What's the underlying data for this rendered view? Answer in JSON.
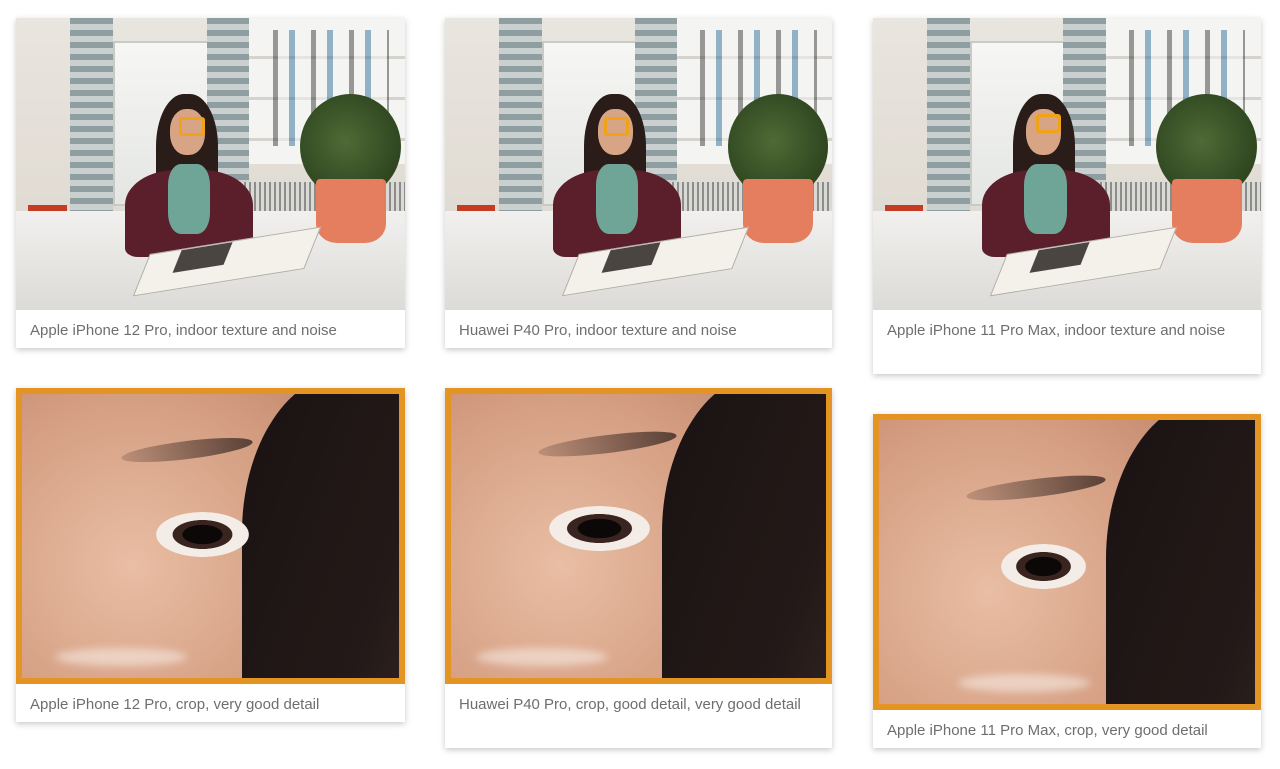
{
  "accent_color": "#e39422",
  "cards": [
    {
      "caption": "Apple iPhone 12 Pro, indoor texture and noise"
    },
    {
      "caption": "Huawei P40 Pro, indoor texture and noise"
    },
    {
      "caption": "Apple iPhone 11 Pro Max, indoor texture and noise"
    },
    {
      "caption": "Apple iPhone 12 Pro, crop, very good detail"
    },
    {
      "caption": "Huawei P40 Pro, crop, good detail, very good detail"
    },
    {
      "caption": "Apple iPhone 11 Pro Max, crop, very good detail"
    }
  ]
}
